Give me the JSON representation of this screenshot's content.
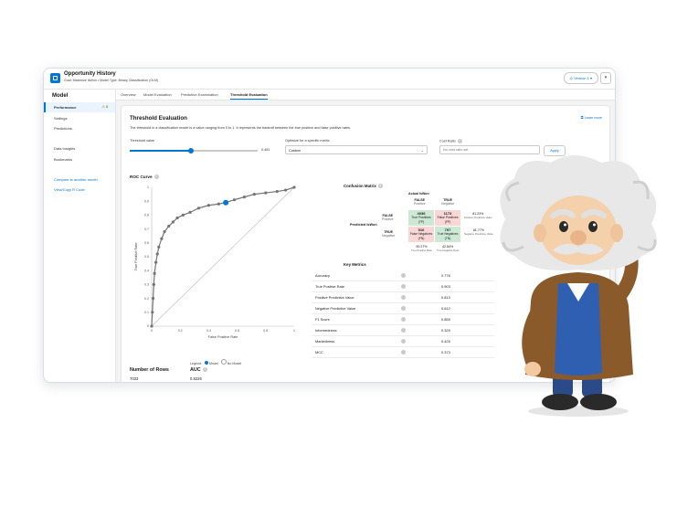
{
  "header": {
    "title": "Opportunity History",
    "subtitle": "Goal: Maximize IsWon • Model Type: Binary Classification (GLM)",
    "version_label": "Version 1",
    "menu_glyph": "▾"
  },
  "sidebar": {
    "heading": "Model",
    "items": [
      {
        "label": "Performance",
        "badge": "3"
      },
      {
        "label": "Settings"
      },
      {
        "label": "Predictions"
      },
      {
        "label": "Data Insights"
      },
      {
        "label": "Bookmarks"
      }
    ],
    "links": [
      "Compare to another model",
      "View/Copy R Code"
    ]
  },
  "tabs": [
    "Overview",
    "Model Evaluation",
    "Predictive Examination",
    "Threshold Evaluation"
  ],
  "threshold": {
    "title": "Threshold Evaluation",
    "learn_more": "Learn more",
    "description": "The threshold in a classification model is a value ranging from 0 to 1. It represents the tradeoff between the true positive and false positive rates.",
    "threshold_label": "Threshold value",
    "threshold_value": "0.481",
    "threshold_fraction": 0.481,
    "optimize_label": "Optimize for a specific metric",
    "optimize_value": "Custom",
    "cost_label": "Cost Ratio",
    "cost_placeholder": "No cost ratio set",
    "apply_label": "Apply"
  },
  "roc": {
    "title": "ROC Curve",
    "xlabel": "False Positive Rate",
    "ylabel": "True Positive Rate",
    "legend_label": "Legend:",
    "legend_model": "Model",
    "legend_no_model": "No Model"
  },
  "chart_data": {
    "type": "line",
    "title": "ROC Curve",
    "xlabel": "False Positive Rate",
    "ylabel": "True Positive Rate",
    "xlim": [
      0,
      1
    ],
    "ylim": [
      0,
      1
    ],
    "x_ticks": [
      "0",
      "0.2",
      "0.4",
      "0.6",
      "0.8",
      "1"
    ],
    "y_ticks": [
      "0",
      "0.1",
      "0.2",
      "0.3",
      "0.4",
      "0.5",
      "0.6",
      "0.7",
      "0.8",
      "0.9",
      "1"
    ],
    "grid": false,
    "legend": "bottom",
    "series": [
      {
        "name": "Model",
        "x": [
          0,
          0.005,
          0.01,
          0.015,
          0.02,
          0.03,
          0.04,
          0.05,
          0.07,
          0.09,
          0.12,
          0.15,
          0.18,
          0.22,
          0.27,
          0.33,
          0.4,
          0.47,
          0.52,
          0.58,
          0.65,
          0.72,
          0.8,
          0.88,
          0.94,
          1
        ],
        "y": [
          0,
          0.1,
          0.2,
          0.3,
          0.38,
          0.46,
          0.52,
          0.57,
          0.63,
          0.68,
          0.72,
          0.75,
          0.78,
          0.8,
          0.82,
          0.85,
          0.87,
          0.88,
          0.89,
          0.91,
          0.93,
          0.95,
          0.96,
          0.97,
          0.98,
          1
        ]
      },
      {
        "name": "No Model",
        "x": [
          0,
          1
        ],
        "y": [
          0,
          1
        ]
      }
    ],
    "highlight": {
      "x": 0.52,
      "y": 0.89
    }
  },
  "stats": {
    "rows_label": "Number of Rows",
    "rows_value": "7033",
    "auc_label": "AUC",
    "auc_value": "0.8226"
  },
  "confusion": {
    "title": "Confusion Matrix",
    "actual_label": "Actual IsWon",
    "predicted_label": "Predicted IsWon",
    "col_false": "FALSE",
    "col_false_sub": "Positive",
    "col_true": "TRUE",
    "col_true_sub": "Negative",
    "row_false": "FALSE",
    "row_false_sub": "Positive",
    "row_true": "TRUE",
    "row_true_sub": "Negative",
    "cells": [
      {
        "value": "4036",
        "label": "True Positives (TP)",
        "color": "#cde8d4"
      },
      {
        "value": "1173",
        "label": "False Positives (FP)",
        "color": "#f8d7d5"
      },
      {
        "value": "516",
        "label": "False Negatives (FN)",
        "color": "#f8d7d5"
      },
      {
        "value": "797",
        "label": "True Negatives (TN)",
        "color": "#cde8d4"
      }
    ],
    "row_pct": [
      {
        "value": "81.23%",
        "label": "Positive Predictive Value"
      },
      {
        "value": "61.77%",
        "label": "Negative Predictive Value"
      }
    ],
    "col_pct": [
      {
        "value": "90.27%",
        "label": "True Positive Rate"
      },
      {
        "value": "42.84%",
        "label": "True Negative Rate"
      }
    ]
  },
  "key_metrics": {
    "title": "Key Metrics",
    "rows": [
      {
        "name": "Accuracy",
        "value": "0.776"
      },
      {
        "name": "True Positive Rate",
        "value": "0.903"
      },
      {
        "name": "Positive Predictive Value",
        "value": "0.813"
      },
      {
        "name": "Negative Predictive Value",
        "value": "0.612"
      },
      {
        "name": "F1 Score",
        "value": "0.855"
      },
      {
        "name": "Informedness",
        "value": "0.329"
      },
      {
        "name": "Markedness",
        "value": "0.425"
      },
      {
        "name": "MCC",
        "value": "0.373"
      }
    ]
  },
  "colors": {
    "accent": "#0176d3",
    "curve": "#747474",
    "highlight": "#0176d3"
  }
}
